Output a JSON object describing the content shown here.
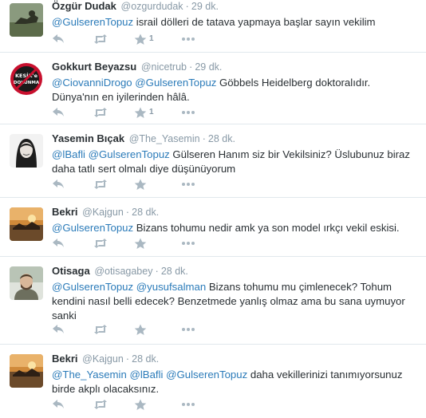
{
  "tweets": [
    {
      "fullname": "Özgür Dudak",
      "handle": "@ozgurdudak",
      "time": "29 dk.",
      "mentions": [
        "@GulserenTopuz"
      ],
      "text": " israil dölleri de tatava yapmaya başlar sayın vekilim",
      "fav_count": "1"
    },
    {
      "fullname": "Gokkurt Beyazsu",
      "handle": "@nicetrub",
      "time": "29 dk.",
      "mentions": [
        "@CiovanniDrogo",
        "@GulserenTopuz"
      ],
      "text": " Göbbels Heidelberg doktoralıdır. Dünya'nın en iyilerinden hâlâ.",
      "fav_count": "1",
      "avatar_text": [
        "KESİK'e",
        "DOKUNMA"
      ]
    },
    {
      "fullname": "Yasemin Bıçak",
      "handle": "@The_Yasemin",
      "time": "28 dk.",
      "mentions": [
        "@lBafli",
        "@GulserenTopuz"
      ],
      "text": " Gülseren Hanım siz bir Vekilsiniz? Üslubunuz biraz daha tatlı sert olmalı diye düşünüyorum",
      "fav_count": ""
    },
    {
      "fullname": "Bekri",
      "handle": "@Kajgun",
      "time": "28 dk.",
      "mentions": [
        "@GulserenTopuz"
      ],
      "text": " Bizans tohumu nedir amk ya son model ırkçı vekil eskisi.",
      "fav_count": ""
    },
    {
      "fullname": "Otisaga",
      "handle": "@otisagabey",
      "time": "28 dk.",
      "mentions": [
        "@GulserenTopuz",
        "@yusufsalman"
      ],
      "text": " Bizans tohumu mu çimlenecek? Tohum kendini nasıl belli edecek? Benzetmede yanlış olmaz ama bu sana uymuyor sanki",
      "fav_count": ""
    },
    {
      "fullname": "Bekri",
      "handle": "@Kajgun",
      "time": "28 dk.",
      "mentions": [
        "@The_Yasemin",
        "@lBafli",
        "@GulserenTopuz"
      ],
      "text": " daha vekillerinizi tanımıyorsunuz birde akplı olacaksınız.",
      "fav_count": ""
    }
  ],
  "icons": {
    "reply": "reply-icon",
    "retweet": "retweet-icon",
    "favorite": "star-icon",
    "more": "more-icon"
  },
  "colors": {
    "mention": "#2b7bb9",
    "meta": "#8899a6",
    "text": "#292f33",
    "action": "#aab8c2",
    "divider": "#e1e8ed"
  }
}
